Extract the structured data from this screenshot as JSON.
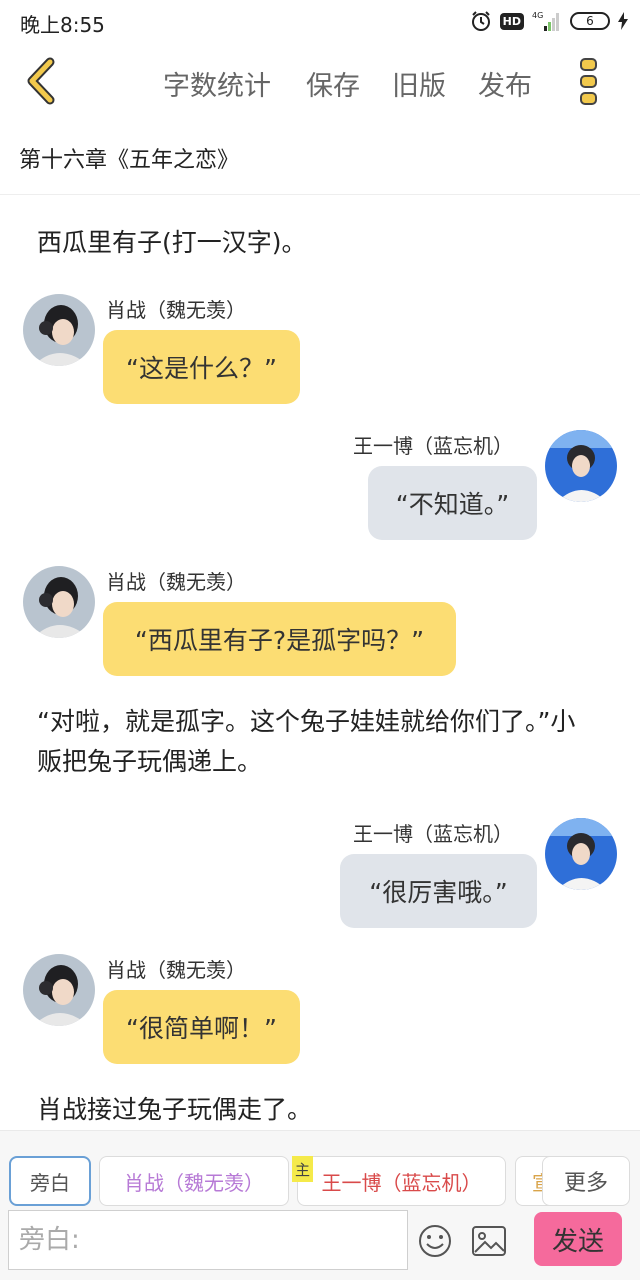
{
  "status": {
    "time": "晚上8:55",
    "hd": "HD",
    "network": "4G",
    "battery": "6"
  },
  "toolbar": {
    "word_count": "字数统计",
    "save": "保存",
    "old_version": "旧版",
    "publish": "发布"
  },
  "chapter": {
    "title": "第十六章《五年之恋》"
  },
  "messages": [
    {
      "type": "narration",
      "text": "西瓜里有子(打一汉字)。"
    },
    {
      "type": "left",
      "speaker": "肖战（魏无羡）",
      "text": "“这是什么？”"
    },
    {
      "type": "right",
      "speaker": "王一博（蓝忘机）",
      "text": "“不知道。”"
    },
    {
      "type": "left",
      "speaker": "肖战（魏无羡）",
      "text": "“西瓜里有子?是孤字吗？”"
    },
    {
      "type": "narration",
      "text": "“对啦，就是孤字。这个兔子娃娃就给你们了。”小贩把兔子玩偶递上。"
    },
    {
      "type": "right",
      "speaker": "王一博（蓝忘机）",
      "text": "“很厉害哦。”"
    },
    {
      "type": "left",
      "speaker": "肖战（魏无羡）",
      "text": "“很简单啊！”"
    },
    {
      "type": "narration",
      "text": "肖战接过兔子玩偶走了。"
    }
  ],
  "roles": {
    "narrator": "旁白",
    "xiao": "肖战（魏无羡）",
    "wang": "王一博（蓝忘机）",
    "partial": "宣",
    "more": "更多",
    "main_tag": "主"
  },
  "input": {
    "placeholder": "旁白:",
    "value": "",
    "send": "发送"
  },
  "colors": {
    "left_bubble": "#fcdd73",
    "right_bubble": "#e0e4ea",
    "send_button": "#f56a9c",
    "back_icon": "#f2c94c"
  }
}
